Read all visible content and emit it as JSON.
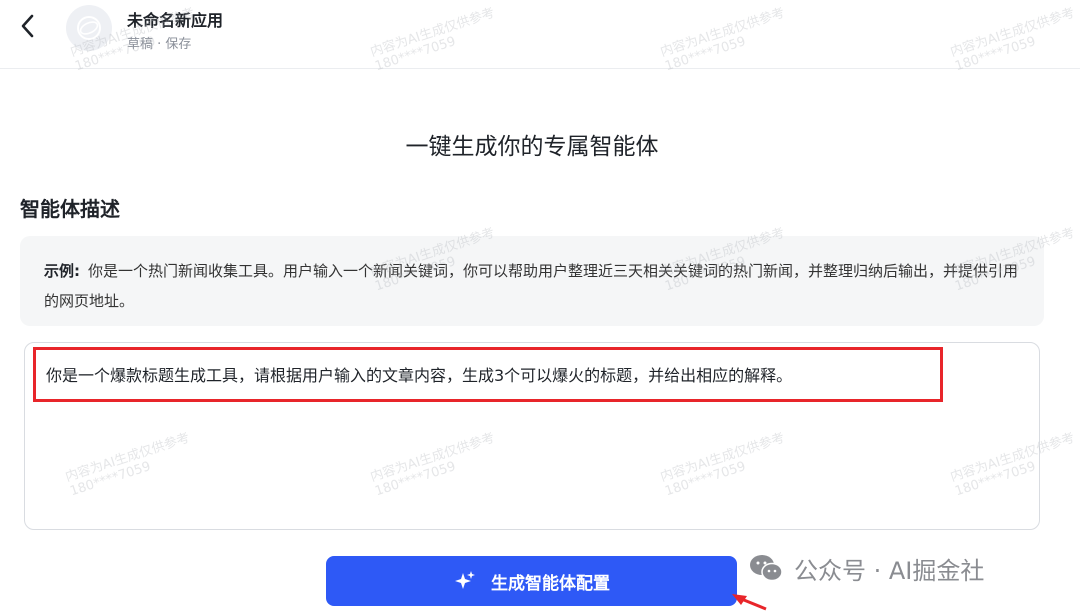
{
  "header": {
    "app_title": "未命名新应用",
    "status": "草稿 · 保存"
  },
  "main": {
    "title": "一键生成你的专属智能体",
    "section_label": "智能体描述",
    "example": {
      "label": "示例:",
      "text": "你是一个热门新闻收集工具。用户输入一个新闻关键词，你可以帮助用户整理近三天相关关键词的热门新闻，并整理归纳后输出，并提供引用的网页地址。"
    },
    "description_value": "你是一个爆款标题生成工具，请根据用户输入的文章内容，生成3个可以爆火的标题，并给出相应的解释。",
    "generate_button": "生成智能体配置"
  },
  "watermark": {
    "line1": "内容为AI生成仅供参考",
    "line2": "180****7059"
  },
  "wechat_label": "公众号 · AI掘金社",
  "colors": {
    "primary": "#2e59f6",
    "highlight_border": "#e8252a",
    "example_bg": "#f5f6f7"
  },
  "icons": {
    "back": "chevron-left-icon",
    "avatar": "app-avatar-icon",
    "generate": "sparkle-icon",
    "wechat": "wechat-icon",
    "annotation": "red-arrow-icon"
  }
}
